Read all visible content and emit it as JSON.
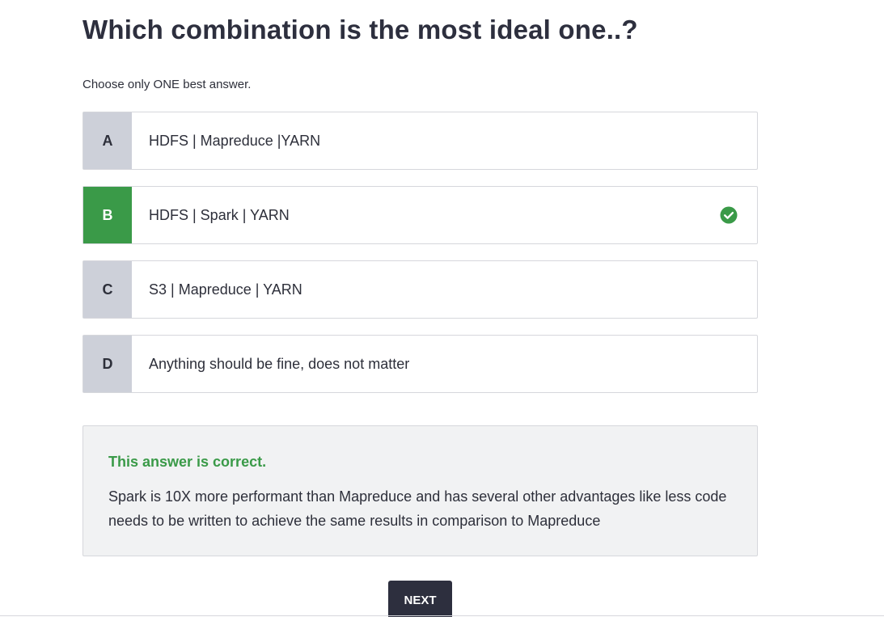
{
  "question": {
    "title": "Which combination is the most ideal one..?",
    "instructions": "Choose only ONE best answer."
  },
  "options": [
    {
      "letter": "A",
      "text": "HDFS | Mapreduce |YARN",
      "state": "default"
    },
    {
      "letter": "B",
      "text": "HDFS | Spark | YARN",
      "state": "correct",
      "icon": "check-circle-icon"
    },
    {
      "letter": "C",
      "text": "S3 | Mapreduce | YARN",
      "state": "default"
    },
    {
      "letter": "D",
      "text": "Anything should be fine, does not matter",
      "state": "default"
    }
  ],
  "feedback": {
    "title": "This answer is correct.",
    "body": "Spark is 10X more performant than Mapreduce and has several other advantages like less code needs to be written to achieve the same results in comparison to Mapreduce"
  },
  "actions": {
    "next_label": "NEXT"
  },
  "colors": {
    "correct": "#3a9a48",
    "letter_bg": "#cdd0d9",
    "primary_dark": "#2d2f3e",
    "feedback_bg": "#f1f2f3"
  }
}
